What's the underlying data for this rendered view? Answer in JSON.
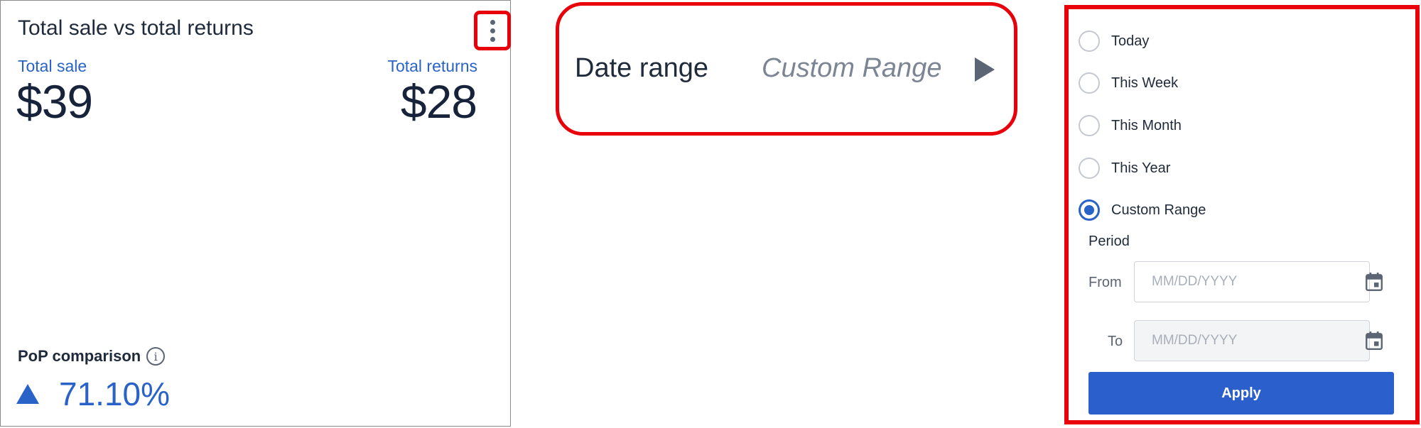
{
  "card": {
    "title": "Total sale vs total returns",
    "total_sale_label": "Total sale",
    "total_sale_value": "$39",
    "total_returns_label": "Total returns",
    "total_returns_value": "$28",
    "pop_label": "PoP comparison",
    "pop_value": "71.10%",
    "pop_direction": "up",
    "icons": {
      "menu": "more-vertical-icon",
      "info": "info-icon",
      "trend": "trend-up-icon"
    }
  },
  "date_range": {
    "label": "Date range",
    "value": "Custom Range",
    "icon": "play-right-icon"
  },
  "options": {
    "radios": [
      {
        "label": "Today",
        "checked": false
      },
      {
        "label": "This Week",
        "checked": false
      },
      {
        "label": "This Month",
        "checked": false
      },
      {
        "label": "This Year",
        "checked": false
      },
      {
        "label": "Custom Range",
        "checked": true
      }
    ],
    "period_label": "Period",
    "from_label": "From",
    "from_placeholder": "MM/DD/YYYY",
    "to_label": "To",
    "to_placeholder": "MM/DD/YYYY",
    "apply_label": "Apply"
  },
  "colors": {
    "accent": "#2a63c7",
    "highlight_border": "#e8000b",
    "text": "#1f2a3a",
    "muted": "#7b8593"
  }
}
